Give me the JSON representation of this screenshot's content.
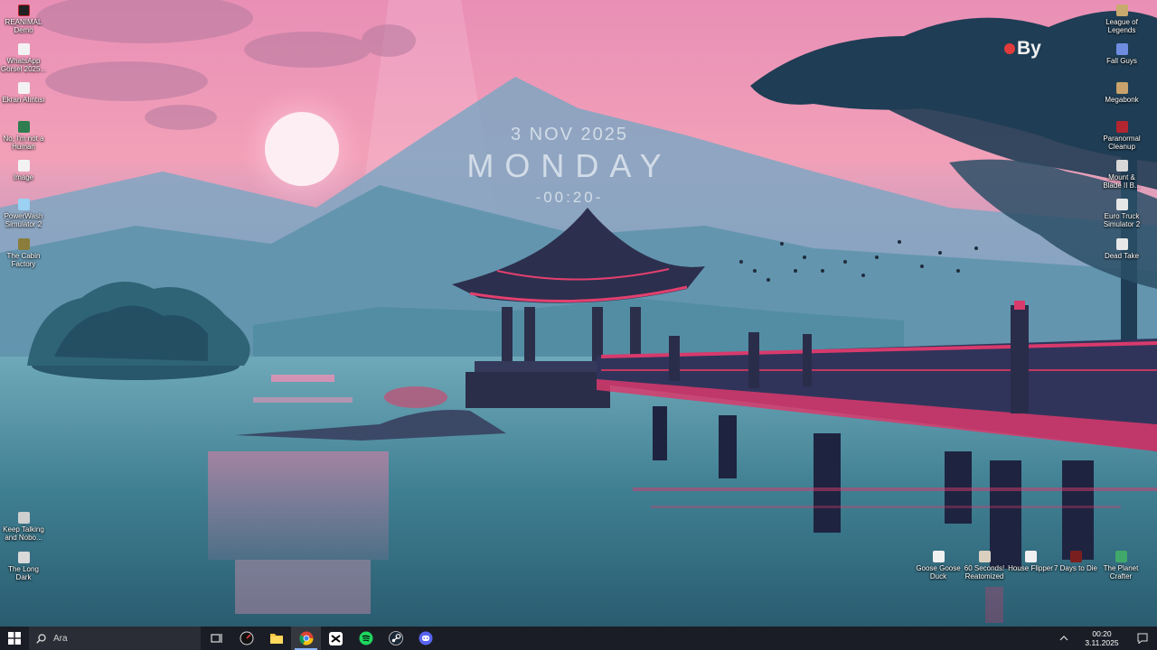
{
  "widget": {
    "date": "3 NOV 2025",
    "day": "MONDAY",
    "time": "-00:20-"
  },
  "badge": {
    "text": "By"
  },
  "desktop_icons": {
    "left": [
      {
        "label": "REANIMAL Demo",
        "icon": "game-icon"
      },
      {
        "label": "WhatsApp Görsel 2025...",
        "icon": "image-file-icon"
      },
      {
        "label": "Ekran Alıntısı",
        "icon": "image-file-icon"
      },
      {
        "label": "No, I'm not a Human",
        "icon": "game-icon"
      },
      {
        "label": "Image",
        "icon": "image-file-icon"
      },
      {
        "label": "PowerWash Simulator 2",
        "icon": "game-icon"
      },
      {
        "label": "The Cabin Factory",
        "icon": "game-icon"
      },
      {
        "label": "Keep Talking and Nobo...",
        "icon": "game-icon"
      },
      {
        "label": "The Long Dark",
        "icon": "game-icon"
      }
    ],
    "right": [
      {
        "label": "League of Legends",
        "icon": "game-icon"
      },
      {
        "label": "Fall Guys",
        "icon": "game-icon"
      },
      {
        "label": "Megabonk",
        "icon": "game-icon"
      },
      {
        "label": "Paranormal Cleanup",
        "icon": "game-icon"
      },
      {
        "label": "Mount & Blade II B...",
        "icon": "game-icon"
      },
      {
        "label": "Euro Truck Simulator 2",
        "icon": "game-icon"
      },
      {
        "label": "Dead Take",
        "icon": "game-icon"
      }
    ],
    "bottom": [
      {
        "label": "Goose Goose Duck",
        "icon": "game-icon"
      },
      {
        "label": "60 Seconds! Reatomized",
        "icon": "game-icon"
      },
      {
        "label": "House Flipper",
        "icon": "game-icon"
      },
      {
        "label": "7 Days to Die",
        "icon": "game-icon"
      },
      {
        "label": "The Planet Crafter",
        "icon": "game-icon"
      }
    ]
  },
  "taskbar": {
    "search_placeholder": "Ara",
    "apps": [
      {
        "name": "task-view",
        "icon": "task-view-icon"
      },
      {
        "name": "hardware-monitor",
        "icon": "gauge-icon"
      },
      {
        "name": "file-explorer",
        "icon": "folder-icon"
      },
      {
        "name": "chrome",
        "icon": "chrome-icon"
      },
      {
        "name": "capcut",
        "icon": "capcut-icon"
      },
      {
        "name": "spotify",
        "icon": "spotify-icon"
      },
      {
        "name": "steam",
        "icon": "steam-icon"
      },
      {
        "name": "discord",
        "icon": "discord-icon"
      }
    ],
    "clock": {
      "time": "00:20",
      "date": "3.11.2025"
    }
  },
  "colors": {
    "taskbar_bg": "#1b1d26",
    "sky_top": "#f4a6c6",
    "water": "#3f7f92",
    "bridge": "#d83a6c"
  }
}
